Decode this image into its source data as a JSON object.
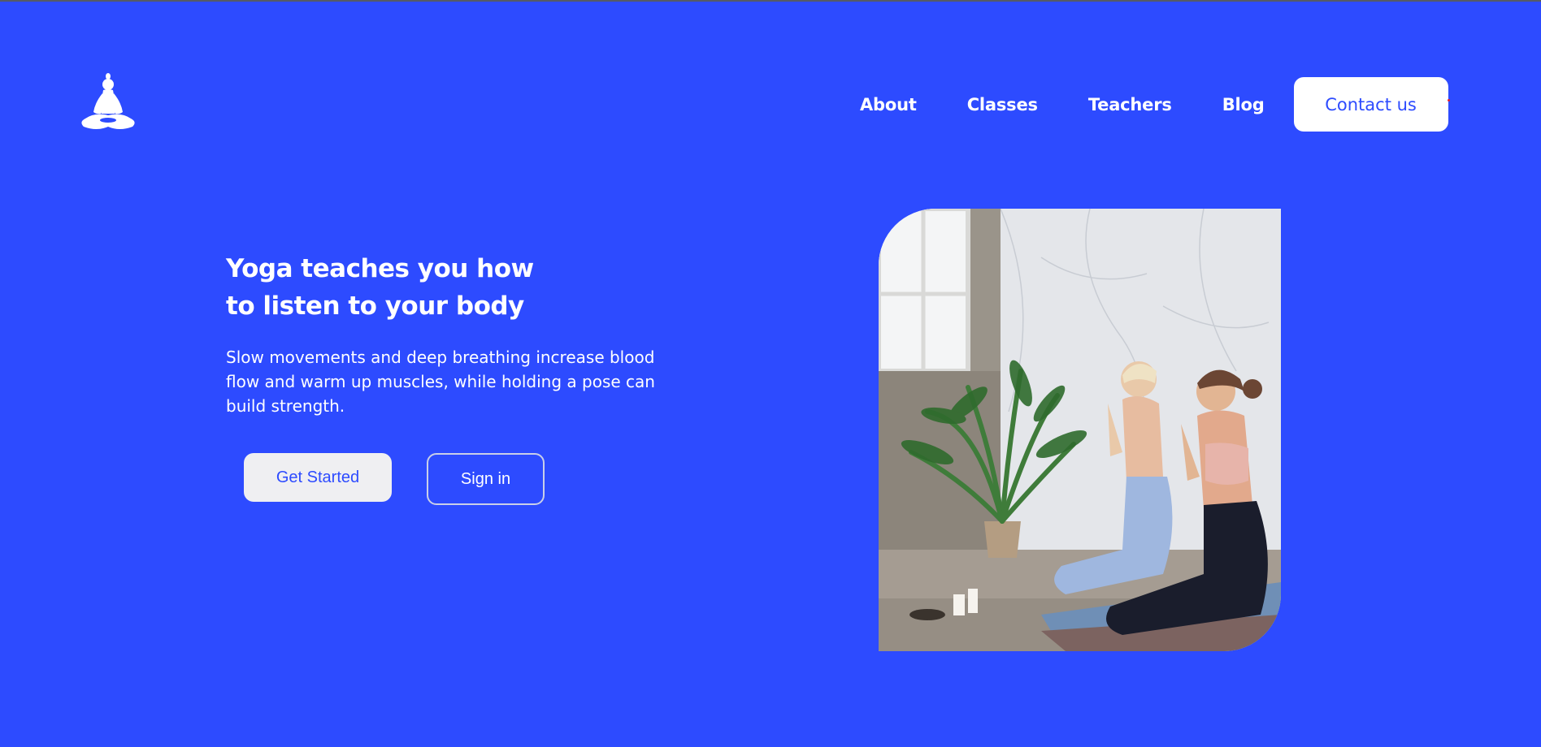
{
  "header": {
    "logo": {
      "icon": "meditation-figure-icon"
    },
    "nav": [
      {
        "label": "About"
      },
      {
        "label": "Classes"
      },
      {
        "label": "Teachers"
      },
      {
        "label": "Blog"
      }
    ],
    "contact_label": "Contact us"
  },
  "hero": {
    "title_line1": "Yoga teaches you how",
    "title_line2": "to listen to your body",
    "description": "Slow movements and deep breathing increase blood flow and warm up muscles, while holding a pose can build strength.",
    "get_started_label": "Get Started",
    "sign_in_label": "Sign in",
    "image": {
      "subject": "two-women-meditating-photo"
    }
  },
  "colors": {
    "background": "#2d4bff",
    "text": "#ffffff",
    "button_light": "#efeff2",
    "accent_dot": "#e8202a"
  }
}
